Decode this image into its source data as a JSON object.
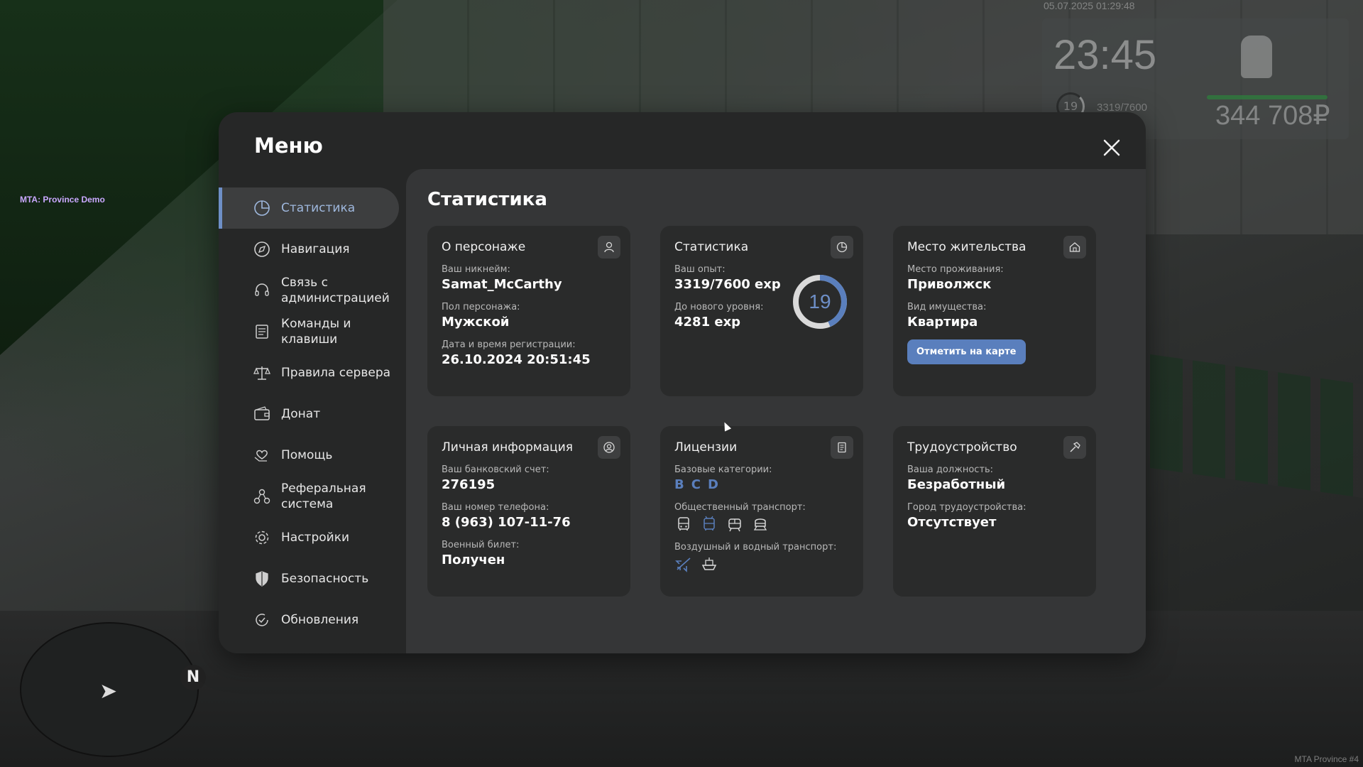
{
  "overlay": {
    "mta_label": "MTA: Province Demo",
    "watermark": "MTA Province #4",
    "hud": {
      "date": "05.07.2025 01:29:48",
      "time": "23:45",
      "level": "19",
      "exp": "3319/7600",
      "money": "344 708₽"
    },
    "minimap_north": "N"
  },
  "menu": {
    "title": "Меню",
    "nav": [
      {
        "label": "Статистика",
        "icon": "chart-pie-icon",
        "active": true
      },
      {
        "label": "Навигация",
        "icon": "compass-icon"
      },
      {
        "label": "Связь с администрацией",
        "icon": "headset-icon"
      },
      {
        "label": "Команды и клавиши",
        "icon": "document-list-icon"
      },
      {
        "label": "Правила сервера",
        "icon": "scales-icon"
      },
      {
        "label": "Донат",
        "icon": "wallet-icon"
      },
      {
        "label": "Помощь",
        "icon": "hand-heart-icon"
      },
      {
        "label": "Реферальная система",
        "icon": "referral-network-icon"
      },
      {
        "label": "Настройки",
        "icon": "gear-icon"
      },
      {
        "label": "Безопасность",
        "icon": "shield-icon"
      },
      {
        "label": "Обновления",
        "icon": "refresh-check-icon"
      }
    ]
  },
  "content": {
    "title": "Статистика",
    "character": {
      "title": "О персонаже",
      "nickname_label": "Ваш никнейм:",
      "nickname": "Samat_McCarthy",
      "gender_label": "Пол персонажа:",
      "gender": "Мужской",
      "reg_label": "Дата и время регистрации:",
      "reg_date": "26.10.2024 20:51:45"
    },
    "stats": {
      "title": "Статистика",
      "exp_label": "Ваш опыт:",
      "exp": "3319/7600 exp",
      "next_label": "До нового уровня:",
      "next": "4281 exp",
      "level": "19",
      "progress": 0.437
    },
    "residence": {
      "title": "Место жительства",
      "place_label": "Место проживания:",
      "place": "Приволжск",
      "property_label": "Вид имущества:",
      "property": "Квартира",
      "map_button": "Отметить на карте"
    },
    "personal": {
      "title": "Личная информация",
      "bank_label": "Ваш банковский счет:",
      "bank": "276195",
      "phone_label": "Ваш номер телефона:",
      "phone": "8 (963) 107-11-76",
      "military_label": "Военный билет:",
      "military": "Получен"
    },
    "licenses": {
      "title": "Лицензии",
      "base_label": "Базовые категории:",
      "categories": [
        "B",
        "C",
        "D"
      ],
      "public_label": "Общественный транспорт:",
      "air_label": "Воздушный и водный транспорт:"
    },
    "employment": {
      "title": "Трудоустройство",
      "position_label": "Ваша должность:",
      "position": "Безработный",
      "city_label": "Город трудоустройства:",
      "city": "Отсутствует"
    }
  },
  "colors": {
    "accent": "#6e8fc7",
    "button": "#5a7fbd",
    "card": "#2a2b2b",
    "panel": "#353637",
    "window": "#262727"
  }
}
